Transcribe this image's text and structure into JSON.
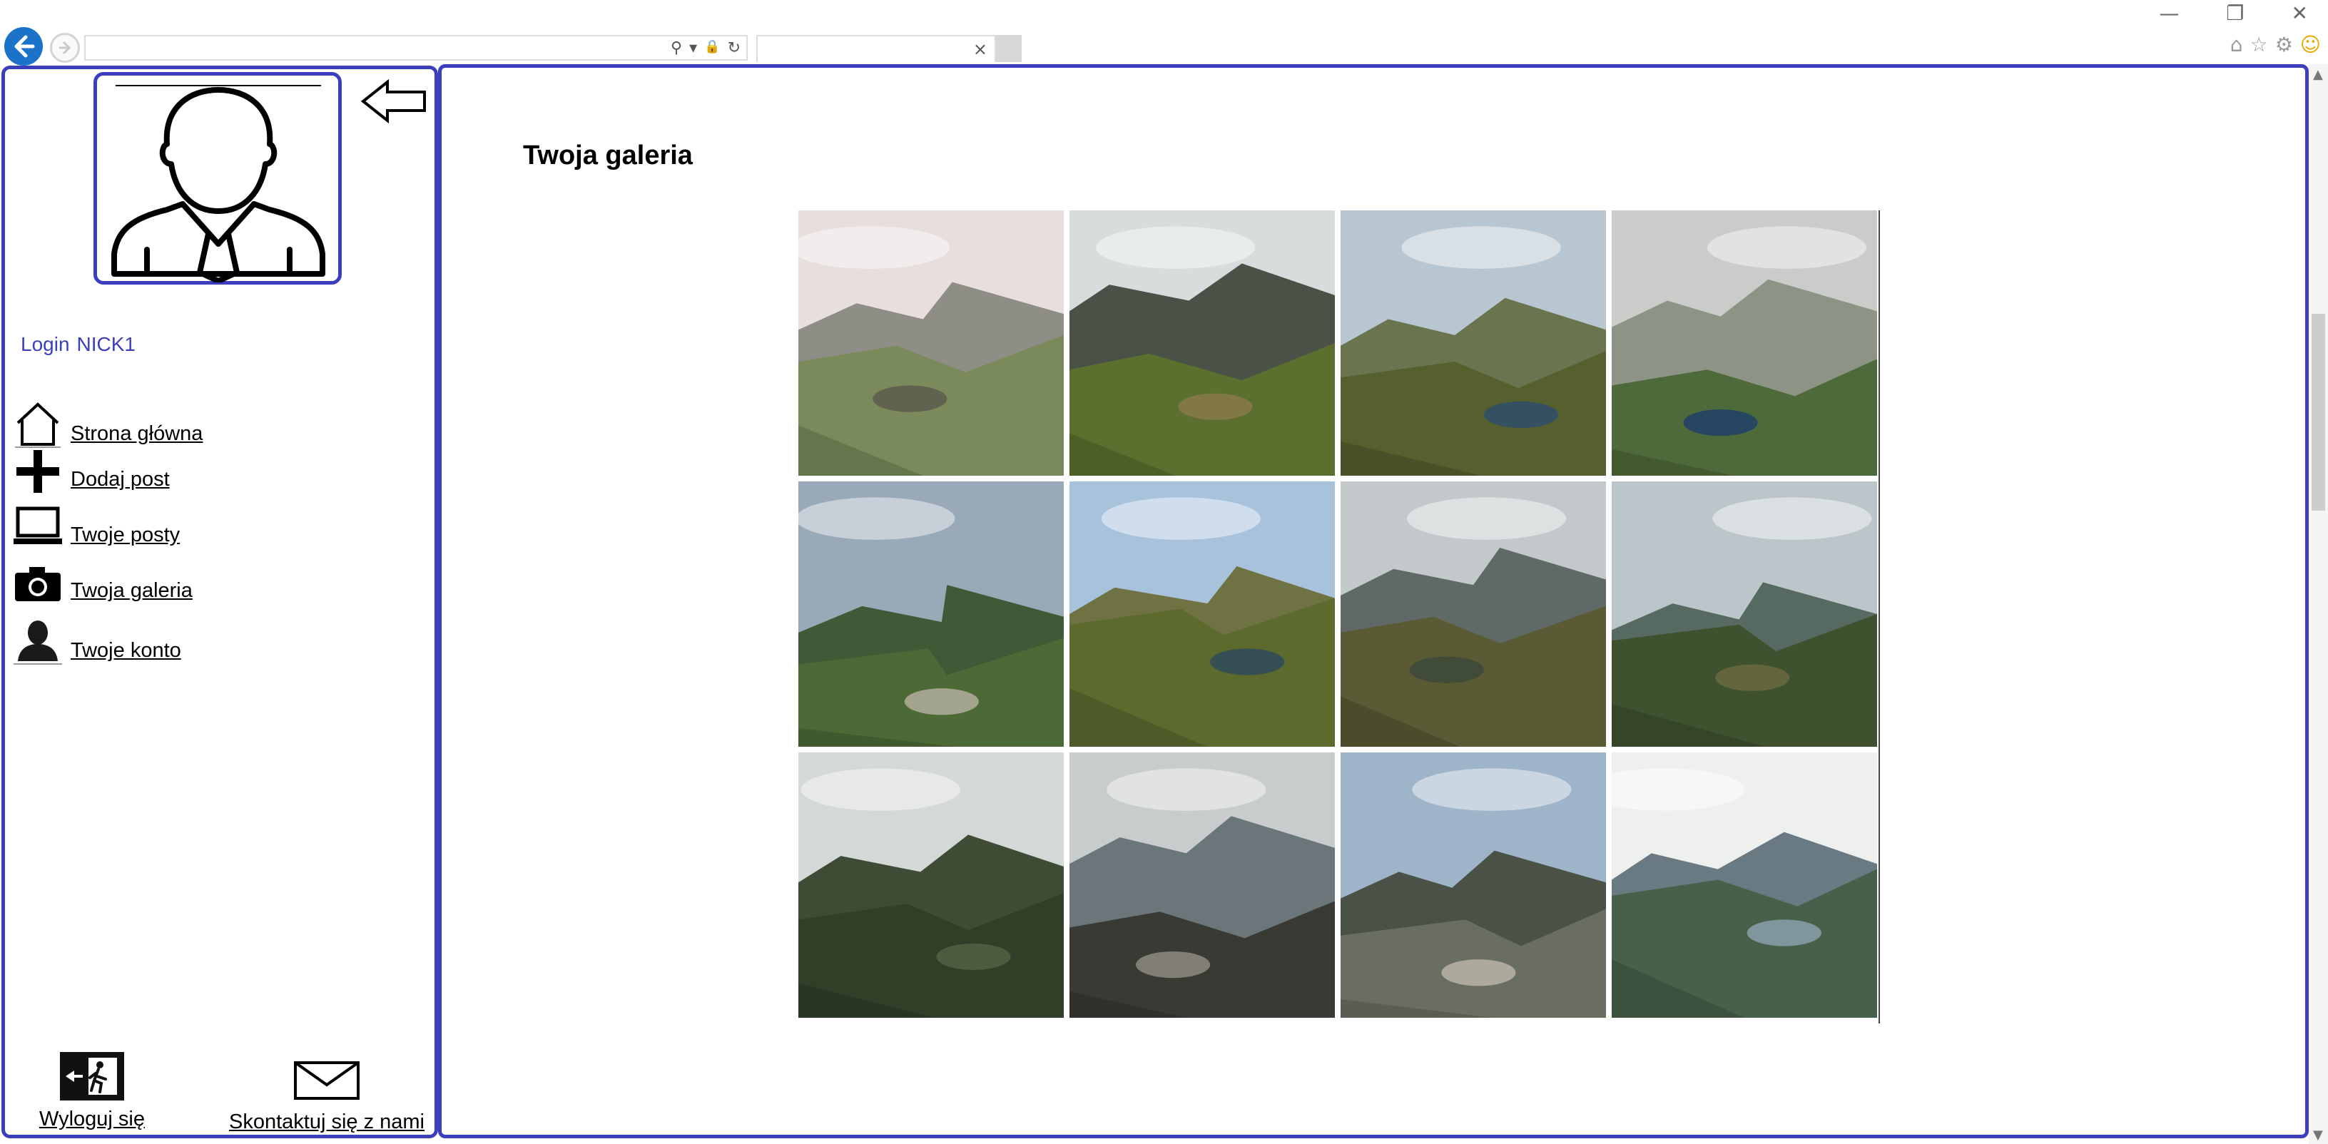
{
  "browser": {
    "address_value": "",
    "tab_title": "",
    "window_controls": [
      "—",
      "❐",
      "✕"
    ],
    "address_icons": [
      "⚲",
      "▾",
      "🔒",
      "↻"
    ],
    "tab_close": "×",
    "favorites_icons": [
      "⌂",
      "☆",
      "⚙",
      "☺"
    ]
  },
  "sidebar": {
    "login_label": "Login",
    "login_value": "NICK1",
    "nav": [
      {
        "label": "Strona główna",
        "icon": "home-icon"
      },
      {
        "label": "Dodaj post",
        "icon": "plus-icon"
      },
      {
        "label": "Twoje posty",
        "icon": "laptop-icon"
      },
      {
        "label": "Twoja galeria",
        "icon": "camera-icon"
      },
      {
        "label": "Twoje konto",
        "icon": "person-icon"
      }
    ],
    "logout_label": "Wyloguj się",
    "contact_label": "Skontaktuj się z nami"
  },
  "main": {
    "title": "Twoja galeria",
    "photos": [
      {
        "alt": "mountain-photo-1",
        "sky": "#e8dede",
        "far": "#8f8e86",
        "near": "#7a8a5a",
        "accent": "#5d5a4e"
      },
      {
        "alt": "mountain-photo-2",
        "sky": "#d8dcdc",
        "far": "#4a5248",
        "near": "#5b6f2e",
        "accent": "#8a7a4a"
      },
      {
        "alt": "mountain-photo-3",
        "sky": "#b8c6d2",
        "far": "#6a7550",
        "near": "#55602e",
        "accent": "#2f4d6a"
      },
      {
        "alt": "mountain-photo-4",
        "sky": "#c9ccc8",
        "far": "#8d9486",
        "near": "#4f6a3a",
        "accent": "#1f3f6a"
      },
      {
        "alt": "mountain-photo-5",
        "sky": "#9aa9b8",
        "far": "#3f5a36",
        "near": "#4d6a36",
        "accent": "#b2ae9c"
      },
      {
        "alt": "mountain-photo-6",
        "sky": "#a9c2dc",
        "far": "#6f7242",
        "near": "#5c6a2e",
        "accent": "#2e4a5c"
      },
      {
        "alt": "mountain-photo-7",
        "sky": "#c3c8ca",
        "far": "#5f6a66",
        "near": "#5a5a34",
        "accent": "#3c4a38"
      },
      {
        "alt": "mountain-photo-8",
        "sky": "#bcc6ca",
        "far": "#576a62",
        "near": "#3e5230",
        "accent": "#6a6a40"
      },
      {
        "alt": "mountain-photo-9",
        "sky": "#d4d8d6",
        "far": "#3e4c36",
        "near": "#2f3f28",
        "accent": "#506042"
      },
      {
        "alt": "mountain-photo-10",
        "sky": "#c8cccc",
        "far": "#6a767a",
        "near": "#3a3a34",
        "accent": "#8e8c80"
      },
      {
        "alt": "mountain-photo-11",
        "sky": "#9eb4c8",
        "far": "#4a5248",
        "near": "#6a6e62",
        "accent": "#b8b4a8"
      },
      {
        "alt": "mountain-photo-12",
        "sky": "#eef0ee",
        "far": "#6a7a82",
        "near": "#48604a",
        "accent": "#8aa0ac"
      }
    ]
  }
}
